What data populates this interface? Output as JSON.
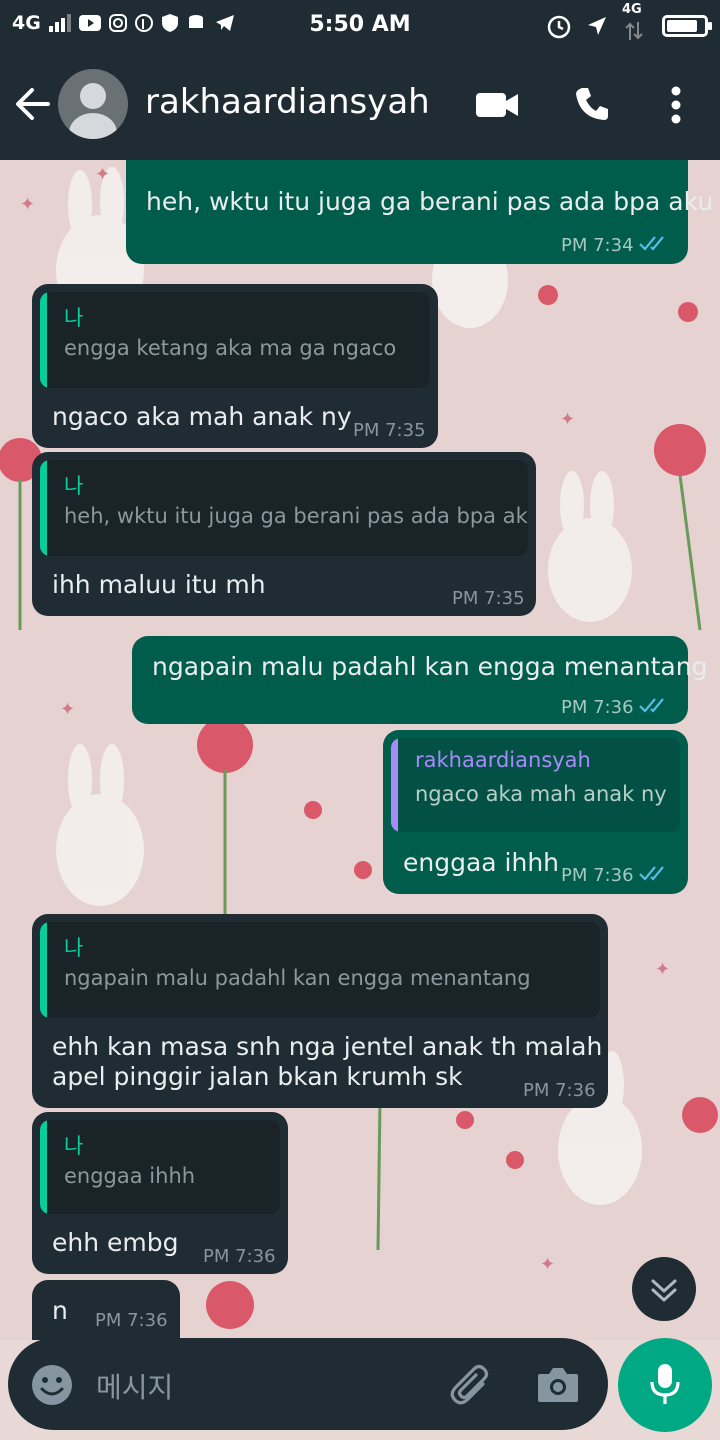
{
  "status_bar": {
    "network_left": "4G",
    "time": "5:50 AM",
    "network_right": "4G"
  },
  "header": {
    "contact_name": "rakhaardiansyah"
  },
  "messages": [
    {
      "direction": "out",
      "text": "heh, wktu itu juga ga berani pas ada bpa aku",
      "time": "PM 7:34"
    },
    {
      "direction": "in",
      "quote_author": "나",
      "quote_text": "engga ketang aka ma ga ngaco",
      "text": "ngaco aka mah anak ny",
      "time": "PM 7:35"
    },
    {
      "direction": "in",
      "quote_author": "나",
      "quote_text": "heh, wktu itu juga ga berani pas ada bpa aku",
      "text": "ihh maluu itu mh",
      "time": "PM 7:35"
    },
    {
      "direction": "out",
      "text": "ngapain malu padahl kan engga menantang",
      "time": "PM 7:36"
    },
    {
      "direction": "out",
      "quote_author": "rakhaardiansyah",
      "quote_text": "ngaco aka mah anak ny",
      "text": "enggaa ihhh",
      "time": "PM 7:36"
    },
    {
      "direction": "in",
      "quote_author": "나",
      "quote_text": "ngapain malu padahl kan engga menantang",
      "text_line1": "ehh kan masa snh nga jentel anak th malah",
      "text_line2": "apel  pinggir jalan bkan krumh sk",
      "time": "PM 7:36"
    },
    {
      "direction": "in",
      "quote_author": "나",
      "quote_text": "enggaa ihhh",
      "text": "ehh embg",
      "time": "PM 7:36"
    },
    {
      "direction": "in",
      "text": "n",
      "time": "PM 7:36"
    }
  ],
  "composer": {
    "placeholder": "메시지"
  },
  "colors": {
    "incoming_bubble": "#202c33",
    "outgoing_bubble": "#005c4b",
    "accent_green": "#00a884",
    "read_ticks": "#53bdeb",
    "quote_self": "#06cf9c",
    "quote_contact": "#a78bfa"
  },
  "icons": [
    "back-arrow-icon",
    "avatar-icon",
    "video-call-icon",
    "phone-icon",
    "more-vert-icon",
    "double-check-icon",
    "scroll-down-icon",
    "emoji-icon",
    "attach-icon",
    "camera-icon",
    "mic-icon"
  ]
}
